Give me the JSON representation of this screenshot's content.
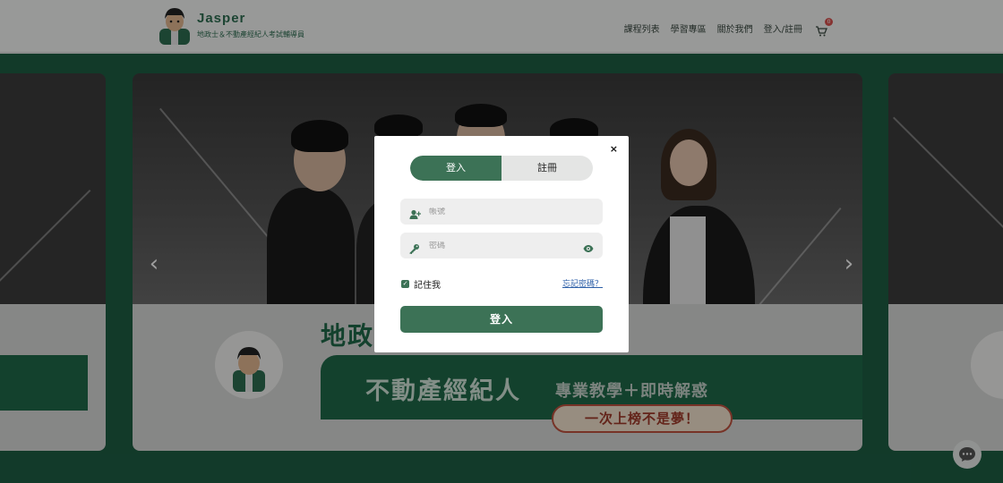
{
  "header": {
    "brand_name": "Jasper",
    "brand_sub": "地政士＆不動產經紀人考試輔導員",
    "nav": [
      "課程列表",
      "學習專區",
      "關於我們",
      "登入/註冊"
    ],
    "cart_count": "0"
  },
  "slide": {
    "title": "地政",
    "band_text": "不動產經紀人",
    "tagline": "專業教學＋即時解惑",
    "pill_text": "一次上榜不是夢！"
  },
  "carousel": {
    "prev_icon": "‹",
    "next_icon": "›"
  },
  "modal": {
    "close_icon": "×",
    "tabs": [
      "登入",
      "註冊"
    ],
    "active_tab": "登入",
    "account_placeholder": "帳號",
    "password_placeholder": "密碼",
    "remember_label": "記住我",
    "remember_checked": true,
    "forgot_label": "忘記密碼？",
    "submit_label": "登入"
  },
  "colors": {
    "brand_green": "#3c7256",
    "hero_green": "#1d5e43",
    "link_blue": "#2d5fa8",
    "badge_red": "#d9534f"
  }
}
